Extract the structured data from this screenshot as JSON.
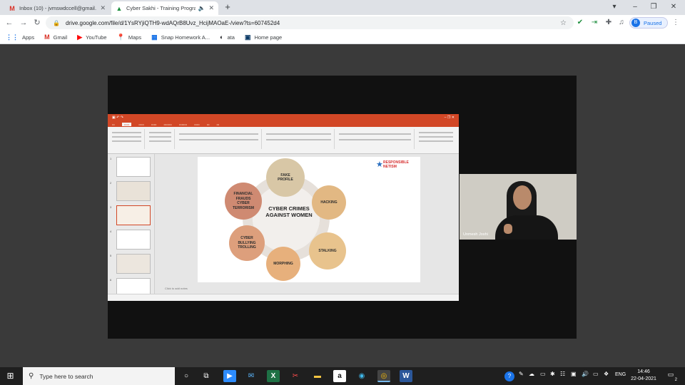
{
  "browser": {
    "tabs": [
      {
        "title": "Inbox (10) - jvmswdccell@gmail.c",
        "favicon": "gmail-icon",
        "active": false
      },
      {
        "title": "Cyber Sakhi - Training Progra",
        "favicon": "drive-icon",
        "active": true
      }
    ],
    "url": "drive.google.com/file/d/1YsRYjiQTH9-wdAQrB8Uvz_HcijMAOaE-/view?ts=607452d4",
    "profile_initial": "B",
    "profile_status": "Paused"
  },
  "bookmarks": [
    {
      "label": "Apps",
      "icon": "apps-grid-icon"
    },
    {
      "label": "Gmail",
      "icon": "gmail-icon"
    },
    {
      "label": "YouTube",
      "icon": "youtube-icon"
    },
    {
      "label": "Maps",
      "icon": "maps-pin-icon"
    },
    {
      "label": "Snap Homework A...",
      "icon": "snap-icon"
    },
    {
      "label": "ata",
      "icon": "ata-icon"
    },
    {
      "label": "Home page",
      "icon": "home-page-icon"
    }
  ],
  "slide": {
    "center_title": "CYBER CRIMES\nAGAINST WOMEN",
    "nodes": [
      {
        "label": "FAKE\nPROFILE",
        "color": "#d8c7a6"
      },
      {
        "label": "HACKING",
        "color": "#e2b883"
      },
      {
        "label": "STALKING",
        "color": "#e8c38d"
      },
      {
        "label": "MORPHING",
        "color": "#e7b07c"
      },
      {
        "label": "CYBER\nBULLYING\nTROLLING",
        "color": "#dd9f7c"
      },
      {
        "label": "FINANCIAL\nFRAUDS\nCYBER\nTERRORISM",
        "color": "#cf8a72"
      }
    ],
    "logo_text": "RESPONSIBLE\nNETISM",
    "notes_placeholder": "Click to add notes"
  },
  "participant": {
    "name": "Unmesh Joshi"
  },
  "taskbar": {
    "search_placeholder": "Type here to search",
    "language": "ENG",
    "time": "14:46",
    "date": "22-04-2021",
    "notification_count": "2"
  }
}
